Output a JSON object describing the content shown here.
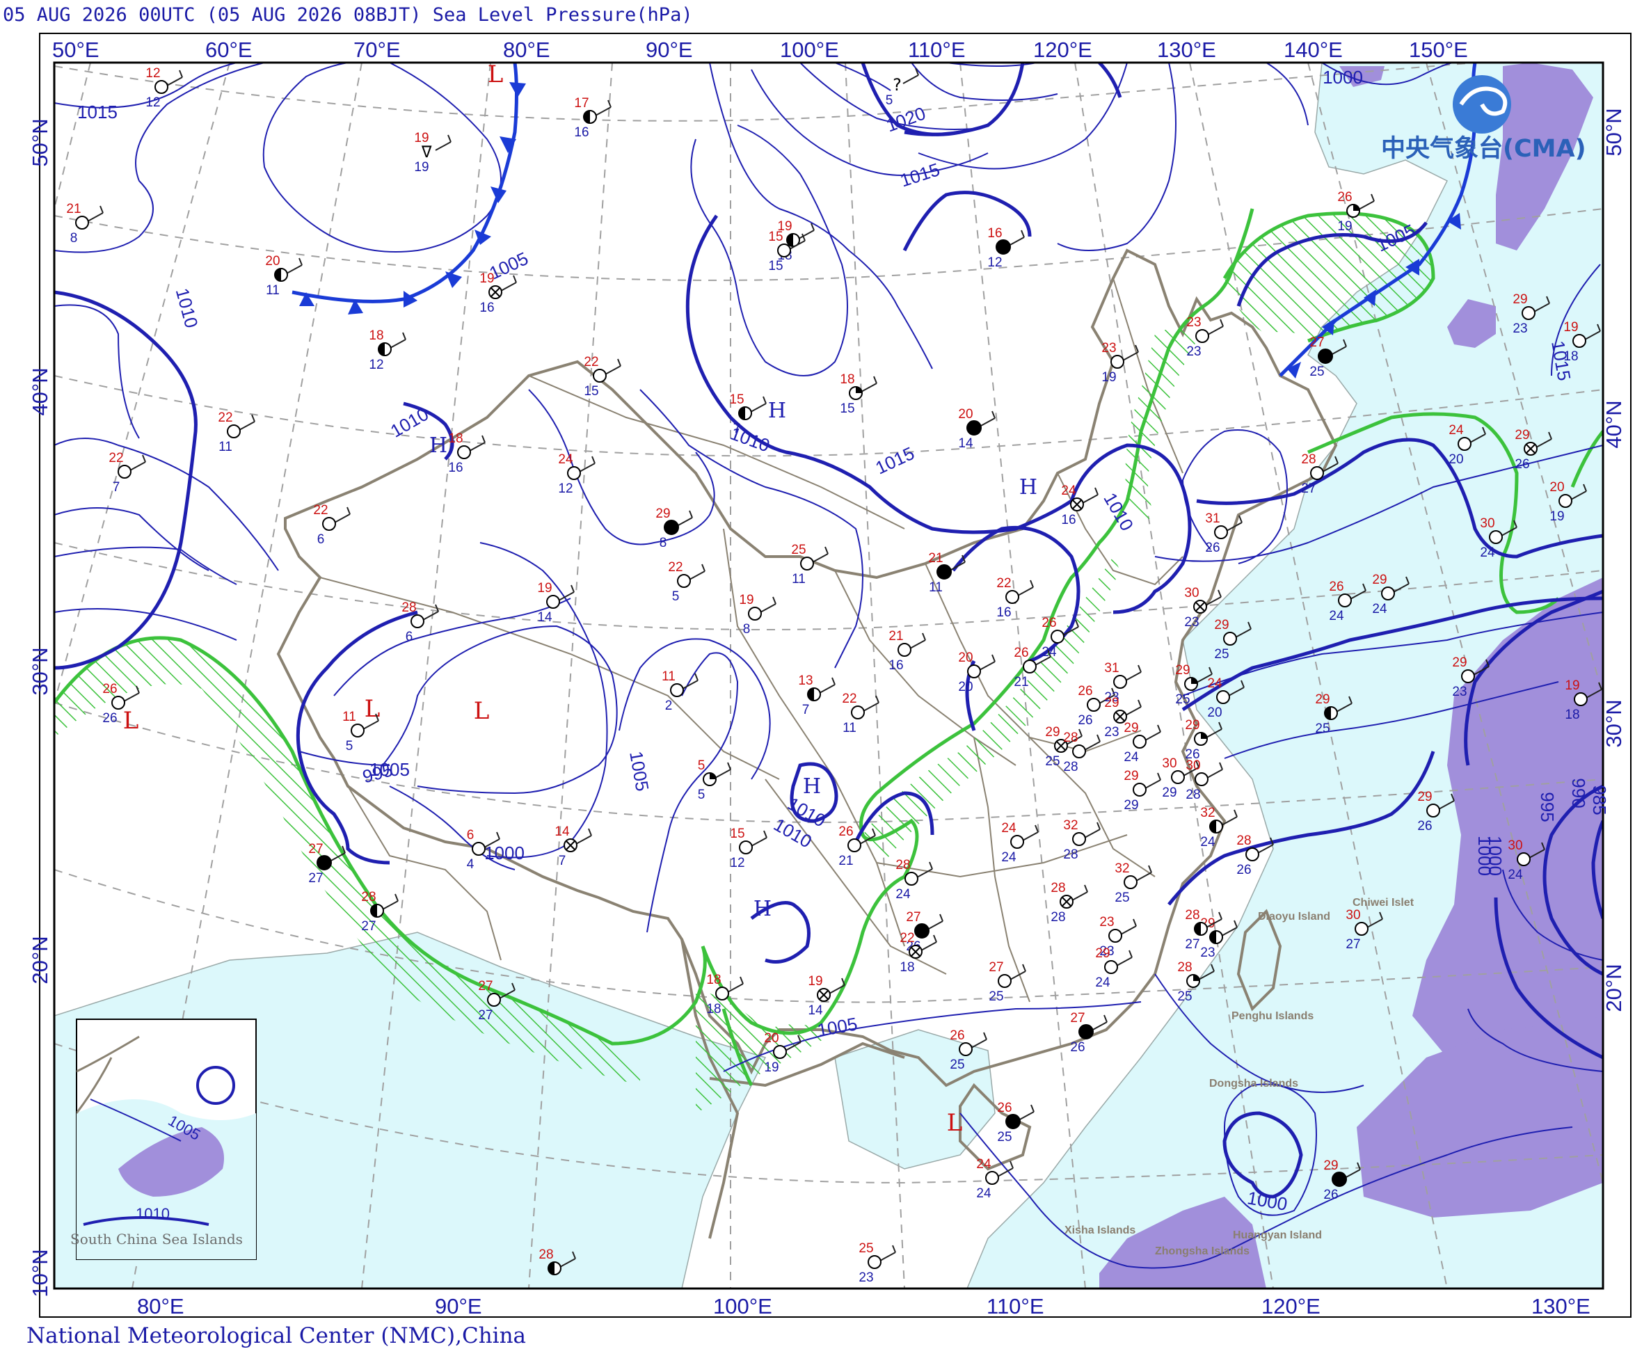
{
  "title": "05 AUG 2026 00UTC (05 AUG 2026 08BJT) Sea Level Pressure(hPa)",
  "footer": "National Meteorological Center (NMC),China",
  "logo": {
    "text": "中央气象台(CMA)",
    "icon": "cma-logo-icon"
  },
  "axes": {
    "top_lon": [
      "50°E",
      "60°E",
      "70°E",
      "80°E",
      "90°E",
      "100°E",
      "110°E",
      "120°E",
      "130°E",
      "140°E",
      "150°E"
    ],
    "bottom_lon": [
      "80°E",
      "90°E",
      "100°E",
      "110°E",
      "120°E",
      "130°E"
    ],
    "left_lat": [
      "50°N",
      "40°N",
      "30°N",
      "20°N",
      "10°N"
    ],
    "right_lat": [
      "50°N",
      "40°N",
      "30°N",
      "20°N"
    ]
  },
  "isobar_labels": [
    "1015",
    "1010",
    "1005",
    "1020",
    "1015",
    "1010",
    "1015",
    "1010",
    "995",
    "1005",
    "1000",
    "1010",
    "1000",
    "1005",
    "1010",
    "1000",
    "995",
    "990",
    "985",
    "1000",
    "1015",
    "1005",
    "1000",
    "1010",
    "1005"
  ],
  "pressure_centers": [
    "L",
    "H",
    "H",
    "H",
    "H",
    "H",
    "L",
    "L",
    "L",
    "L",
    "L",
    "L"
  ],
  "geo_labels": [
    "Chiwei Islet",
    "Diaoyu Island",
    "Penghu Islands",
    "Dongsha Islands",
    "Xisha Islands",
    "Huangyan Island",
    "Zhongsha Islands"
  ],
  "inset": {
    "isobar_labels": [
      "1005",
      "1010"
    ],
    "place_label": "South China Sea Islands"
  },
  "stations": [
    {
      "t": "12",
      "d": "12",
      "sym": "clear"
    },
    {
      "t": "17",
      "d": "16",
      "sym": "half"
    },
    {
      "t": "",
      "d": "5",
      "sym": "missing"
    },
    {
      "t": "21",
      "d": "8",
      "sym": "clear"
    },
    {
      "t": "19",
      "d": "19",
      "sym": "rain"
    },
    {
      "t": "20",
      "d": "11",
      "sym": "half"
    },
    {
      "t": "19",
      "d": "16",
      "sym": "overcast"
    },
    {
      "t": "19",
      "d": "18",
      "sym": "half"
    },
    {
      "t": "16",
      "d": "12",
      "sym": "full"
    },
    {
      "t": "18",
      "d": "12",
      "sym": "half"
    },
    {
      "t": "15",
      "d": "7",
      "sym": "half"
    },
    {
      "t": "18",
      "d": "15",
      "sym": "quarter"
    },
    {
      "t": "20",
      "d": "14",
      "sym": "full"
    },
    {
      "t": "22",
      "d": "11",
      "sym": "clear"
    },
    {
      "t": "22",
      "d": "7",
      "sym": "clear"
    },
    {
      "t": "18",
      "d": "16",
      "sym": "clear"
    },
    {
      "t": "22",
      "d": "15",
      "sym": "clear"
    },
    {
      "t": "24",
      "d": "12",
      "sym": "clear"
    },
    {
      "t": "22",
      "d": "6",
      "sym": "clear"
    },
    {
      "t": "29",
      "d": "8",
      "sym": "full"
    },
    {
      "t": "28",
      "d": "6",
      "sym": "clear"
    },
    {
      "t": "19",
      "d": "14",
      "sym": "clear"
    },
    {
      "t": "22",
      "d": "5",
      "sym": "clear"
    },
    {
      "t": "19",
      "d": "8",
      "sym": "clear"
    },
    {
      "t": "25",
      "d": "11",
      "sym": "clear"
    },
    {
      "t": "21",
      "d": "11",
      "sym": "full"
    },
    {
      "t": "15",
      "d": "15",
      "sym": "clear"
    },
    {
      "t": "23",
      "d": "19",
      "sym": "clear"
    },
    {
      "t": "23",
      "d": "23",
      "sym": "clear"
    },
    {
      "t": "26",
      "d": "19",
      "sym": "quarter"
    },
    {
      "t": "27",
      "d": "25",
      "sym": "full"
    },
    {
      "t": "19",
      "d": "18",
      "sym": "clear"
    },
    {
      "t": "26",
      "d": "24",
      "sym": "clear"
    },
    {
      "t": "29",
      "d": "26",
      "sym": "overcast"
    },
    {
      "t": "28",
      "d": "27",
      "sym": "clear"
    },
    {
      "t": "24",
      "d": "20",
      "sym": "clear"
    },
    {
      "t": "24",
      "d": "16",
      "sym": "overcast"
    },
    {
      "t": "31",
      "d": "26",
      "sym": "clear"
    },
    {
      "t": "30",
      "d": "24",
      "sym": "clear"
    },
    {
      "t": "29",
      "d": "24",
      "sym": "clear"
    },
    {
      "t": "30",
      "d": "23",
      "sym": "overcast"
    },
    {
      "t": "29",
      "d": "25",
      "sym": "clear"
    },
    {
      "t": "29",
      "d": "25",
      "sym": "quarter"
    },
    {
      "t": "22",
      "d": "16",
      "sym": "clear"
    },
    {
      "t": "26",
      "d": "21",
      "sym": "clear"
    },
    {
      "t": "26",
      "d": "24",
      "sym": "clear"
    },
    {
      "t": "20",
      "d": "20",
      "sym": "clear"
    },
    {
      "t": "11",
      "d": "2",
      "sym": "clear"
    },
    {
      "t": "13",
      "d": "7",
      "sym": "half"
    },
    {
      "t": "22",
      "d": "11",
      "sym": "clear"
    },
    {
      "t": "21",
      "d": "16",
      "sym": "clear"
    },
    {
      "t": "26",
      "d": "26",
      "sym": "clear"
    },
    {
      "t": "11",
      "d": "5",
      "sym": "clear"
    },
    {
      "t": "31",
      "d": "23",
      "sym": "clear"
    },
    {
      "t": "29",
      "d": "23",
      "sym": "overcast"
    },
    {
      "t": "29",
      "d": "25",
      "sym": "overcast"
    },
    {
      "t": "29",
      "d": "24",
      "sym": "clear"
    },
    {
      "t": "28",
      "d": "28",
      "sym": "clear"
    },
    {
      "t": "29",
      "d": "26",
      "sym": "quarter"
    },
    {
      "t": "29",
      "d": "25",
      "sym": "half"
    },
    {
      "t": "29",
      "d": "23",
      "sym": "clear"
    },
    {
      "t": "5",
      "d": "5",
      "sym": "quarter"
    },
    {
      "t": "26",
      "d": "21",
      "sym": "clear"
    },
    {
      "t": "24",
      "d": "24",
      "sym": "clear"
    },
    {
      "t": "32",
      "d": "28",
      "sym": "clear"
    },
    {
      "t": "29",
      "d": "29",
      "sym": "clear"
    },
    {
      "t": "30",
      "d": "29",
      "sym": "clear"
    },
    {
      "t": "30",
      "d": "28",
      "sym": "clear"
    },
    {
      "t": "32",
      "d": "24",
      "sym": "half"
    },
    {
      "t": "28",
      "d": "26",
      "sym": "clear"
    },
    {
      "t": "29",
      "d": "26",
      "sym": "clear"
    },
    {
      "t": "27",
      "d": "27",
      "sym": "full"
    },
    {
      "t": "6",
      "d": "4",
      "sym": "clear"
    },
    {
      "t": "14",
      "d": "7",
      "sym": "overcast"
    },
    {
      "t": "15",
      "d": "12",
      "sym": "clear"
    },
    {
      "t": "28",
      "d": "24",
      "sym": "clear"
    },
    {
      "t": "28",
      "d": "28",
      "sym": "overcast"
    },
    {
      "t": "32",
      "d": "25",
      "sym": "clear"
    },
    {
      "t": "29",
      "d": "23",
      "sym": "half"
    },
    {
      "t": "30",
      "d": "27",
      "sym": "clear"
    },
    {
      "t": "23",
      "d": "23",
      "sym": "clear"
    },
    {
      "t": "27",
      "d": "26",
      "sym": "full"
    },
    {
      "t": "22",
      "d": "18",
      "sym": "overcast"
    },
    {
      "t": "27",
      "d": "25",
      "sym": "clear"
    },
    {
      "t": "29",
      "d": "24",
      "sym": "clear"
    },
    {
      "t": "28",
      "d": "25",
      "sym": "quarter"
    },
    {
      "t": "28",
      "d": "27",
      "sym": "half"
    },
    {
      "t": "18",
      "d": "18",
      "sym": "clear"
    },
    {
      "t": "19",
      "d": "14",
      "sym": "overcast"
    },
    {
      "t": "27",
      "d": "26",
      "sym": "full"
    },
    {
      "t": "26",
      "d": "25",
      "sym": "clear"
    },
    {
      "t": "28",
      "d": "27",
      "sym": "half"
    },
    {
      "t": "27",
      "d": "27",
      "sym": "clear"
    },
    {
      "t": "20",
      "d": "19",
      "sym": "clear"
    },
    {
      "t": "26",
      "d": "25",
      "sym": "full"
    },
    {
      "t": "24",
      "d": "24",
      "sym": "clear"
    },
    {
      "t": "25",
      "d": "23",
      "sym": "clear"
    },
    {
      "t": "28",
      "d": "",
      "sym": "half"
    },
    {
      "t": "29",
      "d": "26",
      "sym": "full"
    },
    {
      "t": "30",
      "d": "24",
      "sym": "clear"
    },
    {
      "t": "19",
      "d": "18",
      "sym": "clear"
    },
    {
      "t": "20",
      "d": "19",
      "sym": "clear"
    },
    {
      "t": "24",
      "d": "20",
      "sym": "clear"
    },
    {
      "t": "29",
      "d": "23",
      "sym": "clear"
    },
    {
      "t": "26",
      "d": "26",
      "sym": "clear"
    }
  ],
  "colors": {
    "isobar": "#1f1fb0",
    "cold_front": "#1a3bd6",
    "green_line": "#3cc23c",
    "sea": "#dcf8fb",
    "purple": "#a18fdb",
    "border": "#8a8272",
    "temp": "#cc1111",
    "dew": "#1a1aa6"
  }
}
